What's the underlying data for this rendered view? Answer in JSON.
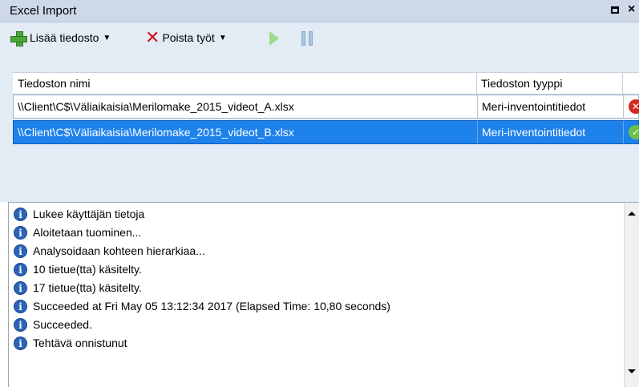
{
  "window": {
    "title": "Excel Import",
    "close_glyph": "×"
  },
  "toolbar": {
    "add_file_label": "Lisää tiedosto",
    "remove_jobs_label": "Poista työt"
  },
  "table": {
    "columns": [
      "Tiedoston nimi",
      "Tiedoston tyyppi"
    ],
    "rows": [
      {
        "file_name": "\\\\Client\\C$\\Väliaikaisia\\Merilomake_2015_videot_A.xlsx",
        "file_type": "Meri-inventointitiedot",
        "status": "error",
        "selected": false
      },
      {
        "file_name": "\\\\Client\\C$\\Väliaikaisia\\Merilomake_2015_videot_B.xlsx",
        "file_type": "Meri-inventointitiedot",
        "status": "success",
        "selected": true
      }
    ]
  },
  "log": {
    "lines": [
      "Lukee käyttäjän tietoja",
      "Aloitetaan tuominen...",
      "Analysoidaan kohteen hierarkiaa...",
      "10 tietue(tta) käsitelty.",
      "17 tietue(tta) käsitelty.",
      "Succeeded at Fri May 05 13:12:34 2017 (Elapsed Time: 10,80 seconds)",
      "Succeeded.",
      "Tehtävä onnistunut"
    ]
  },
  "colors": {
    "titlebar": "#cdd8e8",
    "toolbar": "#e3ebf4",
    "selection": "#1e82eb",
    "info_icon": "#2a64b8"
  }
}
